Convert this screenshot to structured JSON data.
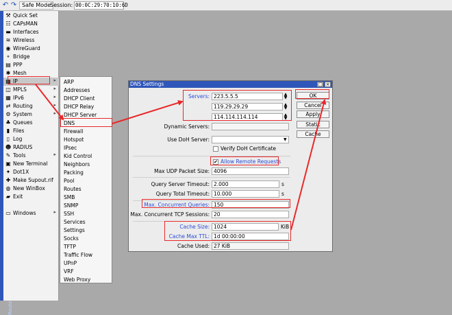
{
  "toolbar": {
    "safe_mode_label": "Safe Mode",
    "session_label": "Session:",
    "session_value": "00:0C:29:70:10:6D"
  },
  "brand": {
    "text": "RouterOS WinBox"
  },
  "sidebar": {
    "items": [
      {
        "label": "Quick Set",
        "icon": "quick-set-icon",
        "glyph": "⚒"
      },
      {
        "label": "CAPsMAN",
        "icon": "capsman-icon",
        "glyph": "☷"
      },
      {
        "label": "Interfaces",
        "icon": "interfaces-icon",
        "glyph": "▬"
      },
      {
        "label": "Wireless",
        "icon": "wireless-icon",
        "glyph": "≋"
      },
      {
        "label": "WireGuard",
        "icon": "wireguard-icon",
        "glyph": "◉"
      },
      {
        "label": "Bridge",
        "icon": "bridge-icon",
        "glyph": "⚬"
      },
      {
        "label": "PPP",
        "icon": "ppp-icon",
        "glyph": "▤"
      },
      {
        "label": "Mesh",
        "icon": "mesh-icon",
        "glyph": "✱"
      },
      {
        "label": "IP",
        "icon": "ip-icon",
        "glyph": "▦",
        "arrow": "▸"
      },
      {
        "label": "MPLS",
        "icon": "mpls-icon",
        "glyph": "◫",
        "arrow": "▸"
      },
      {
        "label": "IPv6",
        "icon": "ipv6-icon",
        "glyph": "▦",
        "arrow": "▸"
      },
      {
        "label": "Routing",
        "icon": "routing-icon",
        "glyph": "⇄",
        "arrow": "▸"
      },
      {
        "label": "System",
        "icon": "system-icon",
        "glyph": "⚙",
        "arrow": "▸"
      },
      {
        "label": "Queues",
        "icon": "queues-icon",
        "glyph": "♣"
      },
      {
        "label": "Files",
        "icon": "files-icon",
        "glyph": "▮"
      },
      {
        "label": "Log",
        "icon": "log-icon",
        "glyph": "▯"
      },
      {
        "label": "RADIUS",
        "icon": "radius-icon",
        "glyph": "☻"
      },
      {
        "label": "Tools",
        "icon": "tools-icon",
        "glyph": "✎",
        "arrow": "▸"
      },
      {
        "label": "New Terminal",
        "icon": "terminal-icon",
        "glyph": "▣"
      },
      {
        "label": "Dot1X",
        "icon": "dot1x-icon",
        "glyph": "✦"
      },
      {
        "label": "Make Supout.rif",
        "icon": "supout-icon",
        "glyph": "✚"
      },
      {
        "label": "New WinBox",
        "icon": "winbox-icon",
        "glyph": "◍"
      },
      {
        "label": "Exit",
        "icon": "exit-icon",
        "glyph": "▰"
      },
      {
        "label": "Windows",
        "icon": "windows-icon",
        "glyph": "▭",
        "arrow": "▸"
      }
    ]
  },
  "ip_menu": {
    "items": [
      "ARP",
      "Addresses",
      "DHCP Client",
      "DHCP Relay",
      "DHCP Server",
      "DNS",
      "Firewall",
      "Hotspot",
      "IPsec",
      "Kid Control",
      "Neighbors",
      "Packing",
      "Pool",
      "Routes",
      "SMB",
      "SNMP",
      "SSH",
      "Services",
      "Settings",
      "Socks",
      "TFTP",
      "Traffic Flow",
      "UPnP",
      "VRF",
      "Web Proxy"
    ]
  },
  "dns_window": {
    "title": "DNS Settings",
    "title_buttons": [
      "□",
      "×"
    ],
    "servers_label": "Servers:",
    "servers": [
      "223.5.5.5",
      "119.29.29.29",
      "114.114.114.114"
    ],
    "dynamic_servers_label": "Dynamic Servers:",
    "dynamic_servers_value": "",
    "use_doh_label": "Use DoH Server:",
    "use_doh_value": "",
    "verify_doh_label": "Verify DoH Certificate",
    "verify_doh_checked": false,
    "allow_remote_label": "Allow Remote Requests",
    "allow_remote_checked": true,
    "check_mark": "✔",
    "max_udp_label": "Max UDP Packet Size:",
    "max_udp_value": "4096",
    "query_server_timeout_label": "Query Server Timeout:",
    "query_server_timeout_value": "2.000",
    "query_total_timeout_label": "Query Total Timeout:",
    "query_total_timeout_value": "10.000",
    "seconds_unit": "s",
    "max_concurrent_label": "Max. Concurrent Queries:",
    "max_concurrent_value": "150",
    "max_tcp_label": "Max. Concurrent TCP Sessions:",
    "max_tcp_value": "20",
    "cache_size_label": "Cache Size:",
    "cache_size_value": "1024",
    "cache_size_unit": "KiB",
    "cache_ttl_label": "Cache Max TTL:",
    "cache_ttl_value": "1d 00:00:00",
    "cache_used_label": "Cache Used:",
    "cache_used_value": "27 KiB",
    "buttons": [
      "OK",
      "Cancel",
      "Apply",
      "Static",
      "Cache"
    ]
  },
  "colors": {
    "accent": "#2f56b9",
    "highlight": "#e8282a",
    "label_blue": "#2a4bd7"
  }
}
